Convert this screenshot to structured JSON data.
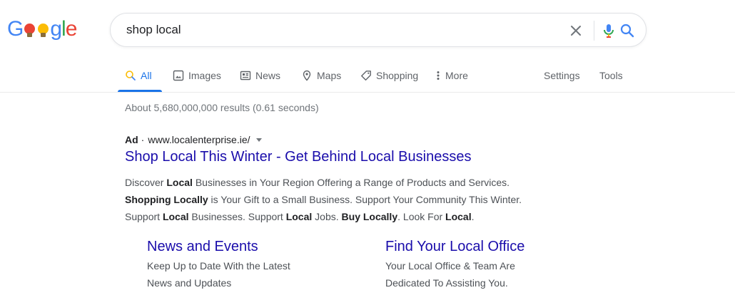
{
  "logo": {
    "g1": "G",
    "g2": "g",
    "l": "l",
    "e": "e"
  },
  "search": {
    "query": "shop local"
  },
  "tabs": [
    {
      "label": "All",
      "icon": "search-icon"
    },
    {
      "label": "Images",
      "icon": "image-icon"
    },
    {
      "label": "News",
      "icon": "news-icon"
    },
    {
      "label": "Maps",
      "icon": "map-pin-icon"
    },
    {
      "label": "Shopping",
      "icon": "tag-icon"
    },
    {
      "label": "More",
      "icon": "more-vert-icon"
    }
  ],
  "tools": {
    "settings": "Settings",
    "tools": "Tools"
  },
  "results": {
    "stats": "About 5,680,000,000 results (0.61 seconds)",
    "ad": {
      "badge": "Ad",
      "separator": "·",
      "url": "www.localenterprise.ie/",
      "title": "Shop Local This Winter - Get Behind Local Businesses",
      "desc1": {
        "a": "Discover ",
        "b": "Local",
        "c": " Businesses in Your Region Offering a Range of Products and Services."
      },
      "desc2": {
        "b": "Shopping Locally",
        "c": " is Your Gift to a Small Business. Support Your Community This Winter."
      },
      "desc3": {
        "a": "Support ",
        "b1": "Local",
        "c": " Businesses. Support ",
        "b2": "Local",
        "d": " Jobs. ",
        "b3": "Buy Locally",
        "e": ". Look For ",
        "b4": "Local",
        "f": "."
      },
      "sitelinks": [
        {
          "title": "News and Events",
          "line1": "Keep Up to Date With the Latest",
          "line2": "News and Updates"
        },
        {
          "title": "Find Your Local Office",
          "line1": "Your Local Office & Team Are",
          "line2": "Dedicated To Assisting You."
        }
      ]
    }
  },
  "colors": {
    "link": "#1a0dab",
    "accent": "#1a73e8",
    "muted": "#70757a"
  }
}
